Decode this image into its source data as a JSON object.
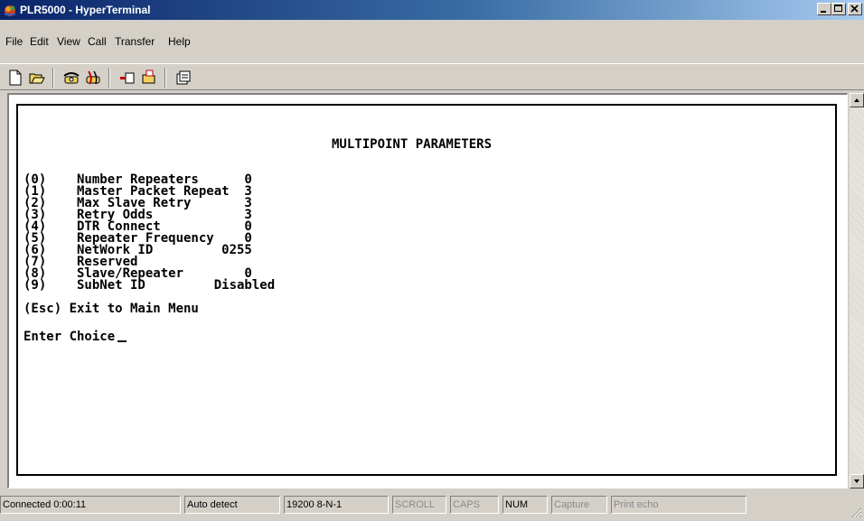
{
  "window": {
    "title": "PLR5000 - HyperTerminal",
    "minimize_label": "_",
    "maximize_label": "□",
    "close_label": "×"
  },
  "menu": [
    "File",
    "Edit",
    "View",
    "Call",
    "Transfer",
    "Help"
  ],
  "toolbar": {
    "buttons": [
      "new-icon",
      "open-icon",
      "connect-phone-icon",
      "disconnect-icon",
      "send-icon",
      "receive-icon",
      "properties-icon"
    ]
  },
  "terminal": {
    "heading": "MULTIPOINT PARAMETERS",
    "rows": [
      "(0)    Number Repeaters      0",
      "(1)    Master Packet Repeat  3",
      "(2)    Max Slave Retry       3",
      "(3)    Retry Odds            3",
      "(4)    DTR Connect           0",
      "(5)    Repeater Frequency    0",
      "(6)    NetWork ID         0255",
      "(7)    Reserved",
      "(8)    Slave/Repeater        0",
      "(9)    SubNet ID         Disabled"
    ],
    "exit_line": "(Esc) Exit to Main Menu",
    "prompt": "Enter Choice"
  },
  "statusbar": {
    "connected": "Connected 0:00:11",
    "detect": "Auto detect",
    "port": "19200 8-N-1",
    "scroll": "SCROLL",
    "caps": "CAPS",
    "num": "NUM",
    "capture": "Capture",
    "print_echo": "Print echo"
  }
}
